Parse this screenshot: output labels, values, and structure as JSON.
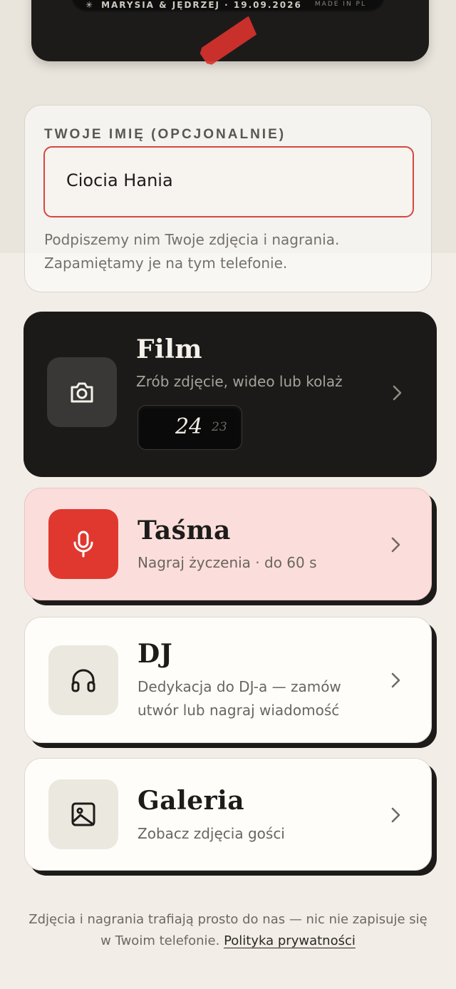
{
  "ticket": {
    "names_date": "MARYSIA & JĘDRZEJ · 19.09.2026",
    "made_in": "MADE IN PL"
  },
  "name_field": {
    "label": "TWOJE IMIĘ (OPCJONALNIE)",
    "value": "Ciocia Hania",
    "help_line1": "Podpiszemy nim Twoje zdjęcia i nagrania.",
    "help_line2": "Zapamiętamy je na tym telefonie."
  },
  "cards": {
    "film": {
      "title": "Film",
      "subtitle": "Zrób zdjęcie, wideo lub kolaż",
      "counter_current": "24",
      "counter_next": "23"
    },
    "tasma": {
      "title": "Taśma",
      "subtitle": "Nagraj życzenia · do 60 s"
    },
    "dj": {
      "title": "DJ",
      "subtitle": "Dedykacja do DJ-a — zamów utwór lub nagraj wiadomość"
    },
    "galeria": {
      "title": "Galeria",
      "subtitle": "Zobacz zdjęcia gości"
    }
  },
  "footer": {
    "text_line1": "Zdjęcia i nagrania trafiają prosto do nas — nic nie zapisuje się",
    "text_line2": "w Twoim telefonie.",
    "privacy_link": "Polityka prywatności"
  },
  "colors": {
    "accent_red": "#e0382f",
    "dark": "#1b1a19",
    "pink": "#fbdedb",
    "background": "#f2ede6"
  },
  "icons": {
    "film": "camera-icon",
    "tasma": "microphone-icon",
    "dj": "headphones-icon",
    "galeria": "image-icon",
    "chevron": "chevron-right-icon",
    "ticket": "sparkle-icon"
  }
}
